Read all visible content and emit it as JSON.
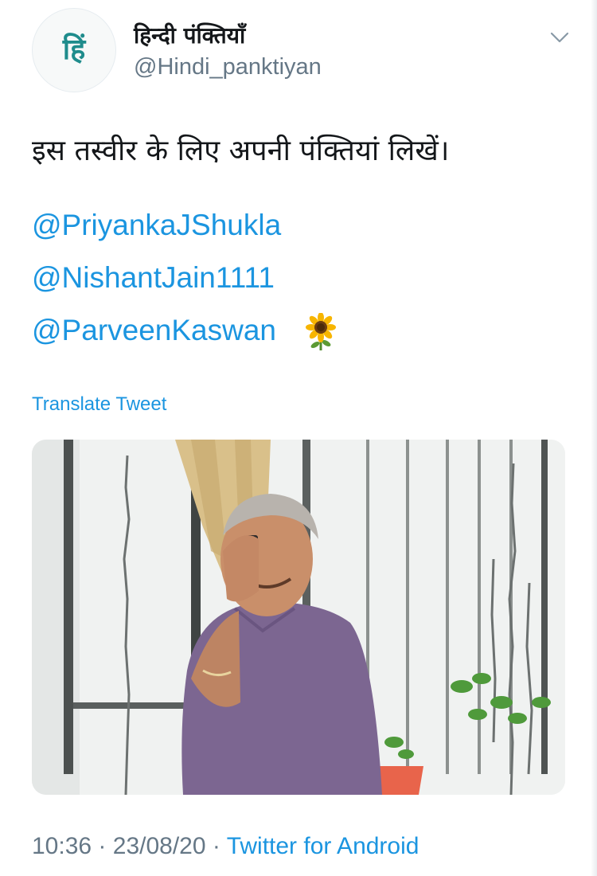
{
  "profile": {
    "display_name": "हिन्दी पंक्तियाँ",
    "handle": "@Hindi_panktiyan",
    "avatar_glyph": "हिं"
  },
  "tweet": {
    "text": "इस तस्वीर के लिए अपनी पंक्तियां लिखें।",
    "mentions": [
      "@PriyankaJShukla",
      "@NishantJain1111",
      "@ParveenKaswan"
    ],
    "emoji": "sunflower-icon",
    "translate_label": "Translate Tweet"
  },
  "meta": {
    "time": "10:36",
    "separator": "·",
    "date": "23/08/20",
    "source": "Twitter for Android"
  },
  "colors": {
    "link": "#1b95e0",
    "text": "#14171a",
    "secondary": "#657786",
    "avatar_accent": "#1f8c8c"
  }
}
